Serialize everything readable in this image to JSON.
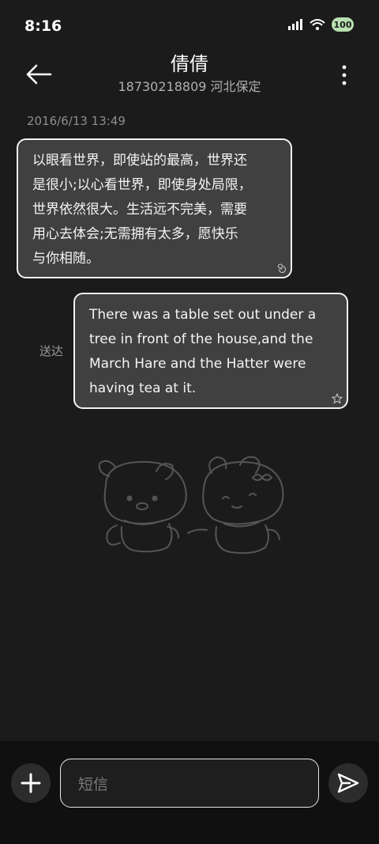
{
  "status_bar": {
    "time": "8:16",
    "battery": "100"
  },
  "header": {
    "title": "倩倩",
    "subtitle": "18730218809 河北保定"
  },
  "conversation": {
    "timestamp": "2016/6/13 13:49",
    "incoming": {
      "lines": [
        "以眼看世界，即使站的最高，世界还",
        "是很小;以心看世界，即使身处局限，",
        "世界依然很大。生活远不完美，需要",
        "用心去体会;无需拥有太多，愿快乐",
        "与你相随。"
      ]
    },
    "outgoing": {
      "status": "送达",
      "lines": [
        "There was a table set out under a",
        "tree in front of the house,and the",
        "March Hare and the Hatter were",
        "having tea at it."
      ]
    }
  },
  "composer": {
    "placeholder": "短信"
  },
  "colors": {
    "background": "#1b1b1b",
    "bubble": "#404040",
    "bubble_border": "#f2f2f2",
    "input_bar": "#101010",
    "battery": "#b8e0b0"
  },
  "icons": [
    "signal-icon",
    "wifi-icon",
    "battery-icon",
    "back-arrow-icon",
    "more-vert-icon",
    "swirl-icon",
    "star-icon",
    "bears-decoration",
    "plus-icon",
    "send-icon"
  ]
}
